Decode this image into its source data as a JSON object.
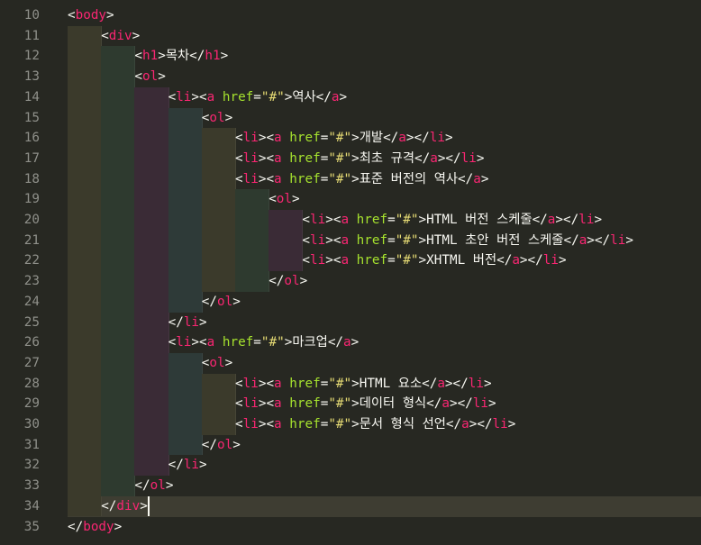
{
  "editor": {
    "line_numbers": [
      10,
      11,
      12,
      13,
      14,
      15,
      16,
      17,
      18,
      19,
      20,
      21,
      22,
      23,
      24,
      25,
      26,
      27,
      28,
      29,
      30,
      31,
      32,
      33,
      34,
      35
    ],
    "active_line": 34,
    "code_lines": [
      {
        "depth": 0,
        "tokens": [
          [
            "p",
            "<"
          ],
          [
            "t",
            "body"
          ],
          [
            "p",
            ">"
          ]
        ]
      },
      {
        "depth": 1,
        "tokens": [
          [
            "p",
            "<"
          ],
          [
            "t",
            "div"
          ],
          [
            "p",
            ">"
          ]
        ]
      },
      {
        "depth": 2,
        "tokens": [
          [
            "p",
            "<"
          ],
          [
            "t",
            "h1"
          ],
          [
            "p",
            ">"
          ],
          [
            "x",
            "목차"
          ],
          [
            "p",
            "</"
          ],
          [
            "t",
            "h1"
          ],
          [
            "p",
            ">"
          ]
        ]
      },
      {
        "depth": 2,
        "tokens": [
          [
            "p",
            "<"
          ],
          [
            "t",
            "ol"
          ],
          [
            "p",
            ">"
          ]
        ]
      },
      {
        "depth": 3,
        "tokens": [
          [
            "p",
            "<"
          ],
          [
            "t",
            "li"
          ],
          [
            "p",
            ">"
          ],
          [
            "p",
            "<"
          ],
          [
            "t",
            "a"
          ],
          [
            "p",
            " "
          ],
          [
            "a",
            "href"
          ],
          [
            "p",
            "="
          ],
          [
            "s",
            "\"#\""
          ],
          [
            "p",
            ">"
          ],
          [
            "x",
            "역사"
          ],
          [
            "p",
            "</"
          ],
          [
            "t",
            "a"
          ],
          [
            "p",
            ">"
          ]
        ]
      },
      {
        "depth": 4,
        "tokens": [
          [
            "p",
            "<"
          ],
          [
            "t",
            "ol"
          ],
          [
            "p",
            ">"
          ]
        ]
      },
      {
        "depth": 5,
        "tokens": [
          [
            "p",
            "<"
          ],
          [
            "t",
            "li"
          ],
          [
            "p",
            ">"
          ],
          [
            "p",
            "<"
          ],
          [
            "t",
            "a"
          ],
          [
            "p",
            " "
          ],
          [
            "a",
            "href"
          ],
          [
            "p",
            "="
          ],
          [
            "s",
            "\"#\""
          ],
          [
            "p",
            ">"
          ],
          [
            "x",
            "개발"
          ],
          [
            "p",
            "</"
          ],
          [
            "t",
            "a"
          ],
          [
            "p",
            ">"
          ],
          [
            "p",
            "</"
          ],
          [
            "t",
            "li"
          ],
          [
            "p",
            ">"
          ]
        ]
      },
      {
        "depth": 5,
        "tokens": [
          [
            "p",
            "<"
          ],
          [
            "t",
            "li"
          ],
          [
            "p",
            ">"
          ],
          [
            "p",
            "<"
          ],
          [
            "t",
            "a"
          ],
          [
            "p",
            " "
          ],
          [
            "a",
            "href"
          ],
          [
            "p",
            "="
          ],
          [
            "s",
            "\"#\""
          ],
          [
            "p",
            ">"
          ],
          [
            "x",
            "최초 규격"
          ],
          [
            "p",
            "</"
          ],
          [
            "t",
            "a"
          ],
          [
            "p",
            ">"
          ],
          [
            "p",
            "</"
          ],
          [
            "t",
            "li"
          ],
          [
            "p",
            ">"
          ]
        ]
      },
      {
        "depth": 5,
        "tokens": [
          [
            "p",
            "<"
          ],
          [
            "t",
            "li"
          ],
          [
            "p",
            ">"
          ],
          [
            "p",
            "<"
          ],
          [
            "t",
            "a"
          ],
          [
            "p",
            " "
          ],
          [
            "a",
            "href"
          ],
          [
            "p",
            "="
          ],
          [
            "s",
            "\"#\""
          ],
          [
            "p",
            ">"
          ],
          [
            "x",
            "표준 버전의 역사"
          ],
          [
            "p",
            "</"
          ],
          [
            "t",
            "a"
          ],
          [
            "p",
            ">"
          ]
        ]
      },
      {
        "depth": 6,
        "tokens": [
          [
            "p",
            "<"
          ],
          [
            "t",
            "ol"
          ],
          [
            "p",
            ">"
          ]
        ]
      },
      {
        "depth": 7,
        "tokens": [
          [
            "p",
            "<"
          ],
          [
            "t",
            "li"
          ],
          [
            "p",
            ">"
          ],
          [
            "p",
            "<"
          ],
          [
            "t",
            "a"
          ],
          [
            "p",
            " "
          ],
          [
            "a",
            "href"
          ],
          [
            "p",
            "="
          ],
          [
            "s",
            "\"#\""
          ],
          [
            "p",
            ">"
          ],
          [
            "x",
            "HTML 버전 스케줄"
          ],
          [
            "p",
            "</"
          ],
          [
            "t",
            "a"
          ],
          [
            "p",
            ">"
          ],
          [
            "p",
            "</"
          ],
          [
            "t",
            "li"
          ],
          [
            "p",
            ">"
          ]
        ]
      },
      {
        "depth": 7,
        "tokens": [
          [
            "p",
            "<"
          ],
          [
            "t",
            "li"
          ],
          [
            "p",
            ">"
          ],
          [
            "p",
            "<"
          ],
          [
            "t",
            "a"
          ],
          [
            "p",
            " "
          ],
          [
            "a",
            "href"
          ],
          [
            "p",
            "="
          ],
          [
            "s",
            "\"#\""
          ],
          [
            "p",
            ">"
          ],
          [
            "x",
            "HTML 초안 버전 스케줄"
          ],
          [
            "p",
            "</"
          ],
          [
            "t",
            "a"
          ],
          [
            "p",
            ">"
          ],
          [
            "p",
            "</"
          ],
          [
            "t",
            "li"
          ],
          [
            "p",
            ">"
          ]
        ]
      },
      {
        "depth": 7,
        "tokens": [
          [
            "p",
            "<"
          ],
          [
            "t",
            "li"
          ],
          [
            "p",
            ">"
          ],
          [
            "p",
            "<"
          ],
          [
            "t",
            "a"
          ],
          [
            "p",
            " "
          ],
          [
            "a",
            "href"
          ],
          [
            "p",
            "="
          ],
          [
            "s",
            "\"#\""
          ],
          [
            "p",
            ">"
          ],
          [
            "x",
            "XHTML 버전"
          ],
          [
            "p",
            "</"
          ],
          [
            "t",
            "a"
          ],
          [
            "p",
            ">"
          ],
          [
            "p",
            "</"
          ],
          [
            "t",
            "li"
          ],
          [
            "p",
            ">"
          ]
        ]
      },
      {
        "depth": 6,
        "tokens": [
          [
            "p",
            "</"
          ],
          [
            "t",
            "ol"
          ],
          [
            "p",
            ">"
          ]
        ]
      },
      {
        "depth": 4,
        "tokens": [
          [
            "p",
            "</"
          ],
          [
            "t",
            "ol"
          ],
          [
            "p",
            ">"
          ]
        ]
      },
      {
        "depth": 3,
        "tokens": [
          [
            "p",
            "</"
          ],
          [
            "t",
            "li"
          ],
          [
            "p",
            ">"
          ]
        ]
      },
      {
        "depth": 3,
        "tokens": [
          [
            "p",
            "<"
          ],
          [
            "t",
            "li"
          ],
          [
            "p",
            ">"
          ],
          [
            "p",
            "<"
          ],
          [
            "t",
            "a"
          ],
          [
            "p",
            " "
          ],
          [
            "a",
            "href"
          ],
          [
            "p",
            "="
          ],
          [
            "s",
            "\"#\""
          ],
          [
            "p",
            ">"
          ],
          [
            "x",
            "마크업"
          ],
          [
            "p",
            "</"
          ],
          [
            "t",
            "a"
          ],
          [
            "p",
            ">"
          ]
        ]
      },
      {
        "depth": 4,
        "tokens": [
          [
            "p",
            "<"
          ],
          [
            "t",
            "ol"
          ],
          [
            "p",
            ">"
          ]
        ]
      },
      {
        "depth": 5,
        "tokens": [
          [
            "p",
            "<"
          ],
          [
            "t",
            "li"
          ],
          [
            "p",
            ">"
          ],
          [
            "p",
            "<"
          ],
          [
            "t",
            "a"
          ],
          [
            "p",
            " "
          ],
          [
            "a",
            "href"
          ],
          [
            "p",
            "="
          ],
          [
            "s",
            "\"#\""
          ],
          [
            "p",
            ">"
          ],
          [
            "x",
            "HTML 요소"
          ],
          [
            "p",
            "</"
          ],
          [
            "t",
            "a"
          ],
          [
            "p",
            ">"
          ],
          [
            "p",
            "</"
          ],
          [
            "t",
            "li"
          ],
          [
            "p",
            ">"
          ]
        ]
      },
      {
        "depth": 5,
        "tokens": [
          [
            "p",
            "<"
          ],
          [
            "t",
            "li"
          ],
          [
            "p",
            ">"
          ],
          [
            "p",
            "<"
          ],
          [
            "t",
            "a"
          ],
          [
            "p",
            " "
          ],
          [
            "a",
            "href"
          ],
          [
            "p",
            "="
          ],
          [
            "s",
            "\"#\""
          ],
          [
            "p",
            ">"
          ],
          [
            "x",
            "데이터 형식"
          ],
          [
            "p",
            "</"
          ],
          [
            "t",
            "a"
          ],
          [
            "p",
            ">"
          ],
          [
            "p",
            "</"
          ],
          [
            "t",
            "li"
          ],
          [
            "p",
            ">"
          ]
        ]
      },
      {
        "depth": 5,
        "tokens": [
          [
            "p",
            "<"
          ],
          [
            "t",
            "li"
          ],
          [
            "p",
            ">"
          ],
          [
            "p",
            "<"
          ],
          [
            "t",
            "a"
          ],
          [
            "p",
            " "
          ],
          [
            "a",
            "href"
          ],
          [
            "p",
            "="
          ],
          [
            "s",
            "\"#\""
          ],
          [
            "p",
            ">"
          ],
          [
            "x",
            "문서 형식 선언"
          ],
          [
            "p",
            "</"
          ],
          [
            "t",
            "a"
          ],
          [
            "p",
            ">"
          ],
          [
            "p",
            "</"
          ],
          [
            "t",
            "li"
          ],
          [
            "p",
            ">"
          ]
        ]
      },
      {
        "depth": 4,
        "tokens": [
          [
            "p",
            "</"
          ],
          [
            "t",
            "ol"
          ],
          [
            "p",
            ">"
          ]
        ]
      },
      {
        "depth": 3,
        "tokens": [
          [
            "p",
            "</"
          ],
          [
            "t",
            "li"
          ],
          [
            "p",
            ">"
          ]
        ]
      },
      {
        "depth": 2,
        "tokens": [
          [
            "p",
            "</"
          ],
          [
            "t",
            "ol"
          ],
          [
            "p",
            ">"
          ]
        ]
      },
      {
        "depth": 1,
        "tokens": [
          [
            "p",
            "</"
          ],
          [
            "t",
            "div"
          ],
          [
            "p",
            ">"
          ]
        ]
      },
      {
        "depth": 0,
        "tokens": [
          [
            "p",
            "</"
          ],
          [
            "t",
            "body"
          ],
          [
            "p",
            ">"
          ]
        ]
      }
    ],
    "colors": {
      "background": "#272822",
      "tag": "#F92672",
      "attribute": "#A6E22E",
      "string": "#E6DB74",
      "text": "#F8F8F2",
      "line_number": "#8F908A",
      "active_line": "#3E3D32"
    }
  }
}
